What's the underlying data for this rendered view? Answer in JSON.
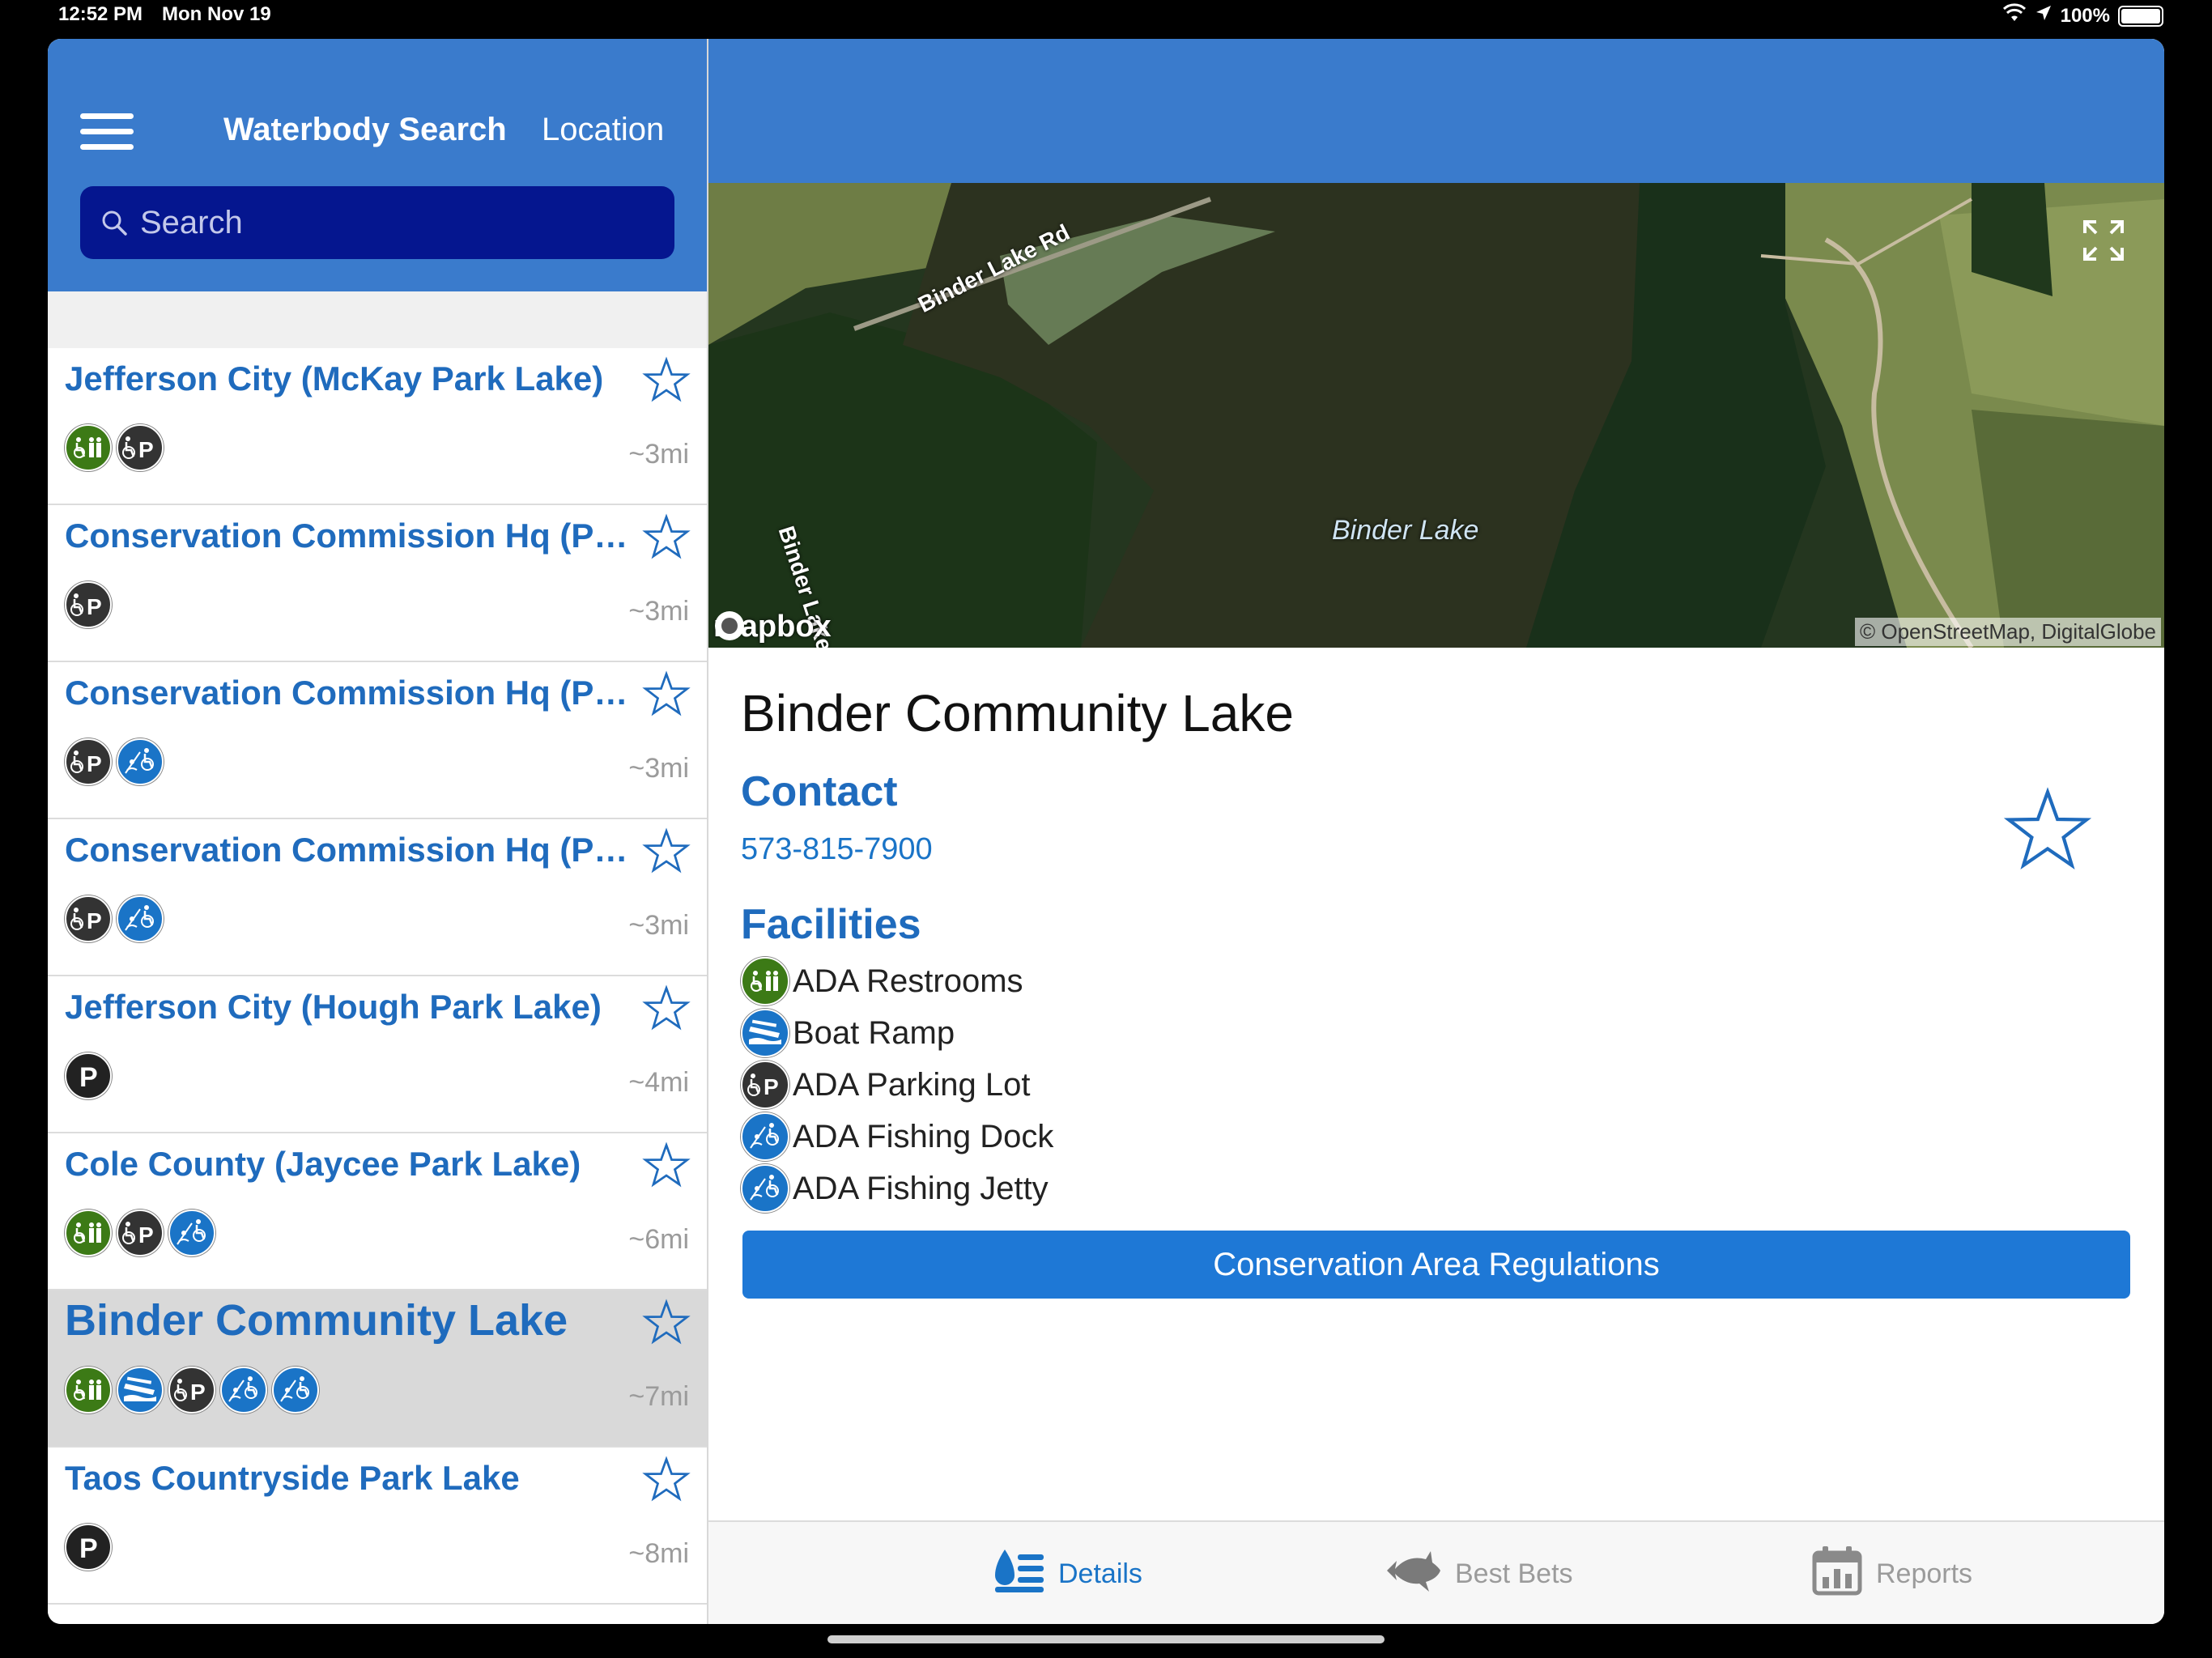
{
  "status_bar": {
    "time": "12:52 PM",
    "date": "Mon Nov 19",
    "battery": "100%"
  },
  "left_header": {
    "title": "Waterbody Search",
    "location": "Location",
    "search_placeholder": "Search"
  },
  "list": [
    {
      "name": "Jefferson City (McKay Park Lake)",
      "distance": "~3mi",
      "icons": [
        "ada-restroom-icon",
        "ada-parking-icon"
      ]
    },
    {
      "name": "Conservation Commission Hq (Po...",
      "distance": "~3mi",
      "icons": [
        "ada-parking-icon"
      ]
    },
    {
      "name": "Conservation Commission Hq (Po...",
      "distance": "~3mi",
      "icons": [
        "ada-parking-icon",
        "ada-fishing-icon"
      ]
    },
    {
      "name": "Conservation Commission Hq (Po...",
      "distance": "~3mi",
      "icons": [
        "ada-parking-icon",
        "ada-fishing-icon"
      ]
    },
    {
      "name": "Jefferson City (Hough Park Lake)",
      "distance": "~4mi",
      "icons": [
        "parking-icon"
      ]
    },
    {
      "name": "Cole County (Jaycee Park Lake)",
      "distance": "~6mi",
      "icons": [
        "ada-restroom-icon",
        "ada-parking-icon",
        "ada-fishing-icon"
      ]
    },
    {
      "name": "Binder Community Lake",
      "distance": "~7mi",
      "selected": true,
      "icons": [
        "ada-restroom-icon",
        "boat-ramp-icon",
        "ada-parking-icon",
        "ada-fishing-icon",
        "ada-fishing-jetty-icon"
      ]
    },
    {
      "name": "Taos Countryside Park Lake",
      "distance": "~8mi",
      "icons": [
        "parking-icon"
      ]
    }
  ],
  "map": {
    "road_label_1": "Binder Lake Rd",
    "road_label_2": "Binder Lake Rd",
    "lake_label": "Binder Lake",
    "attribution": "© OpenStreetMap, DigitalGlobe",
    "logo": "mapbox"
  },
  "detail": {
    "title": "Binder Community Lake",
    "contact_heading": "Contact",
    "phone": "573-815-7900",
    "facilities_heading": "Facilities",
    "facilities": [
      {
        "label": "ADA Restrooms",
        "icon": "ada-restroom-icon"
      },
      {
        "label": "Boat Ramp",
        "icon": "boat-ramp-icon"
      },
      {
        "label": "ADA Parking Lot",
        "icon": "ada-parking-icon"
      },
      {
        "label": "ADA Fishing Dock",
        "icon": "ada-fishing-dock-icon"
      },
      {
        "label": "ADA Fishing Jetty",
        "icon": "ada-fishing-jetty-icon"
      }
    ],
    "regulations_button": "Conservation Area Regulations"
  },
  "tabs": [
    {
      "label": "Details",
      "active": true
    },
    {
      "label": "Best Bets",
      "active": false
    },
    {
      "label": "Reports",
      "active": false
    }
  ],
  "colors": {
    "header_blue": "#3a7bcc",
    "link_blue": "#1f6bbd",
    "button_blue": "#1e78d6",
    "search_bg": "#05168f"
  }
}
